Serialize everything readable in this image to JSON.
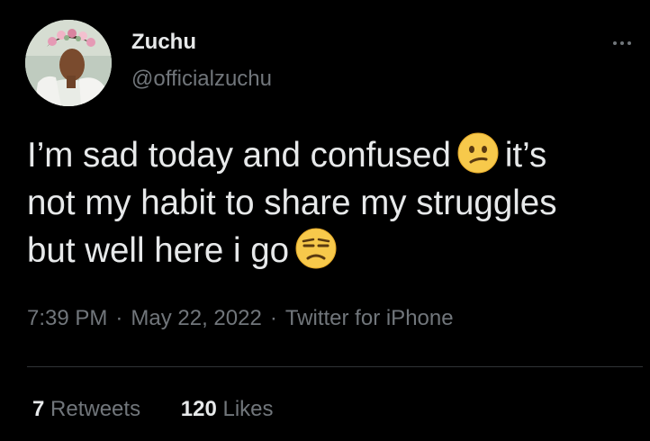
{
  "author": {
    "name": "Zuchu",
    "handle": "@officialzuchu"
  },
  "tweet": {
    "lines": [
      {
        "text": "I’m sad today and confused",
        "emoji_after": "confused-face",
        "trailing": "it’s"
      },
      {
        "text": "not my habit to share my struggles"
      },
      {
        "text": "but well here i go",
        "emoji_after": "unamused-face"
      }
    ]
  },
  "meta": {
    "time": "7:39 PM",
    "separator": "·",
    "date": "May 22, 2022",
    "source": "Twitter for iPhone"
  },
  "stats": {
    "retweets": {
      "count": "7",
      "label": "Retweets"
    },
    "likes": {
      "count": "120",
      "label": "Likes"
    }
  },
  "icons": {
    "more": "more-horizontal-icon"
  },
  "colors": {
    "background": "#000000",
    "primary_text": "#e7e9ea",
    "secondary_text": "#71767b",
    "divider": "#2f3336",
    "emoji_face": "#f7c94b"
  }
}
